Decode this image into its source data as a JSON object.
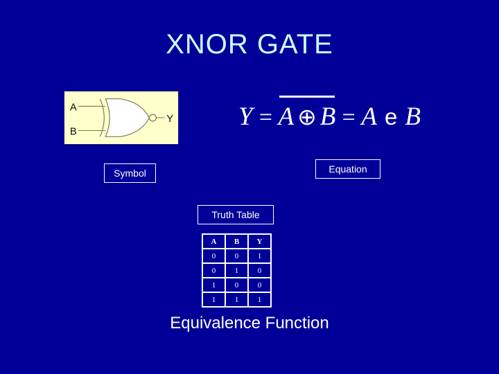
{
  "slide": {
    "title": "XNOR GATE",
    "background_color": "#000099",
    "title_color": "#ccffff",
    "bottom_caption": "Equivalence Function"
  },
  "symbol": {
    "label": "Symbol",
    "box_fill": "#ffffcc",
    "gate_fill": "#ffffff",
    "input_a": "A",
    "input_b": "B",
    "output_y": "Y"
  },
  "equation": {
    "label": "Equation",
    "y": "Y",
    "equals_1": "=",
    "a_1": "A",
    "xor_operator": "⊕",
    "b_1": "B",
    "equals_2": "=",
    "a_2": "A",
    "xnor_operator": "e",
    "b_2": "B",
    "overbar": true,
    "plain_text": "Y = A ⊕ B = A e B"
  },
  "truth_table": {
    "label": "Truth Table",
    "headers": [
      "A",
      "B",
      "Y"
    ],
    "rows": [
      [
        "0",
        "0",
        "1"
      ],
      [
        "0",
        "1",
        "0"
      ],
      [
        "1",
        "0",
        "0"
      ],
      [
        "1",
        "1",
        "1"
      ]
    ]
  }
}
